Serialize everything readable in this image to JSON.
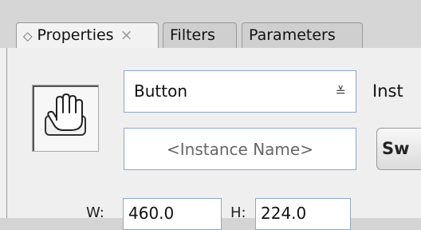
{
  "tabs": [
    {
      "label": "Properties",
      "active": true,
      "close": "×"
    },
    {
      "label": "Filters",
      "active": false
    },
    {
      "label": "Parameters",
      "active": false
    }
  ],
  "symbol_icon": "hand-cursor-icon",
  "instance_type": {
    "selected": "Button",
    "label_truncated": "Inst"
  },
  "instance_name": {
    "placeholder": "<Instance Name>"
  },
  "swap_button": {
    "label_truncated": "Sw"
  },
  "dimensions": {
    "width_label": "W:",
    "height_label": "H:",
    "width_value": "460.0",
    "height_value": "224.0"
  }
}
